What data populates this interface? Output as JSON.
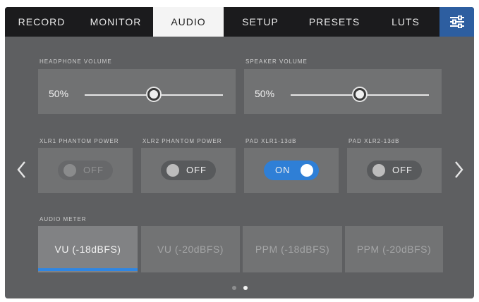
{
  "tabs": [
    {
      "label": "RECORD"
    },
    {
      "label": "MONITOR"
    },
    {
      "label": "AUDIO"
    },
    {
      "label": "SETUP"
    },
    {
      "label": "PRESETS"
    },
    {
      "label": "LUTS"
    }
  ],
  "active_tab": "AUDIO",
  "menu_icon": "sliders-icon",
  "headphone": {
    "label": "HEADPHONE VOLUME",
    "value": "50%",
    "level": 0.5
  },
  "speaker": {
    "label": "SPEAKER VOLUME",
    "value": "50%",
    "level": 0.5
  },
  "toggles": [
    {
      "label": "XLR1 PHANTOM POWER",
      "state": "OFF",
      "enabled": false
    },
    {
      "label": "XLR2 PHANTOM POWER",
      "state": "OFF",
      "enabled": true
    },
    {
      "label": "PAD XLR1-13dB",
      "state": "ON",
      "enabled": true
    },
    {
      "label": "PAD XLR2-13dB",
      "state": "OFF",
      "enabled": true
    }
  ],
  "audio_meter": {
    "label": "AUDIO METER",
    "options": [
      "VU (-18dBFS)",
      "VU (-20dBFS)",
      "PPM (-18dBFS)",
      "PPM (-20dBFS)"
    ],
    "selected": "VU (-18dBFS)"
  },
  "navigation": {
    "prev_icon": "chevron-left-icon",
    "next_icon": "chevron-right-icon"
  },
  "page_indicator": {
    "pages": 2,
    "current": 2
  },
  "colors": {
    "accent": "#2f86e3",
    "menu_button": "#2d5ea0",
    "tabbar": "#1b1b1d"
  }
}
